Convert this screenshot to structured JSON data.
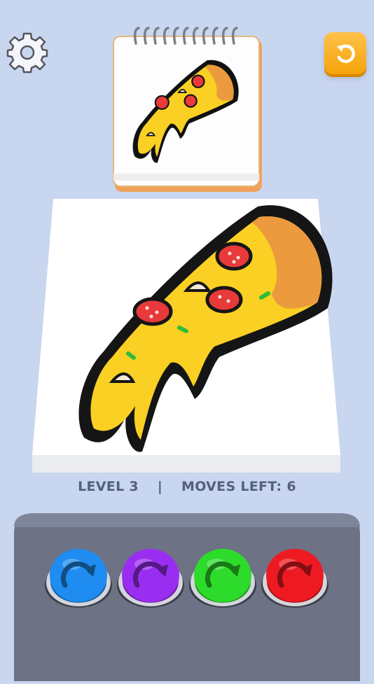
{
  "hud": {
    "level_text": "LEVEL 3",
    "separator": "|",
    "moves_text": "MOVES LEFT: 6"
  },
  "icons": {
    "settings": "gear-icon",
    "restart": "undo-icon"
  },
  "target_card": {
    "subject": "pizza-slice"
  },
  "color_buttons": [
    {
      "name": "blue",
      "color": "#1e8cf0"
    },
    {
      "name": "purple",
      "color": "#9a2ef0"
    },
    {
      "name": "green",
      "color": "#2ddc2a"
    },
    {
      "name": "red",
      "color": "#ee1a22"
    }
  ],
  "colors": {
    "background": "#c9d6f0",
    "accent_orange": "#f5a30a",
    "tray": "#6d7285"
  }
}
